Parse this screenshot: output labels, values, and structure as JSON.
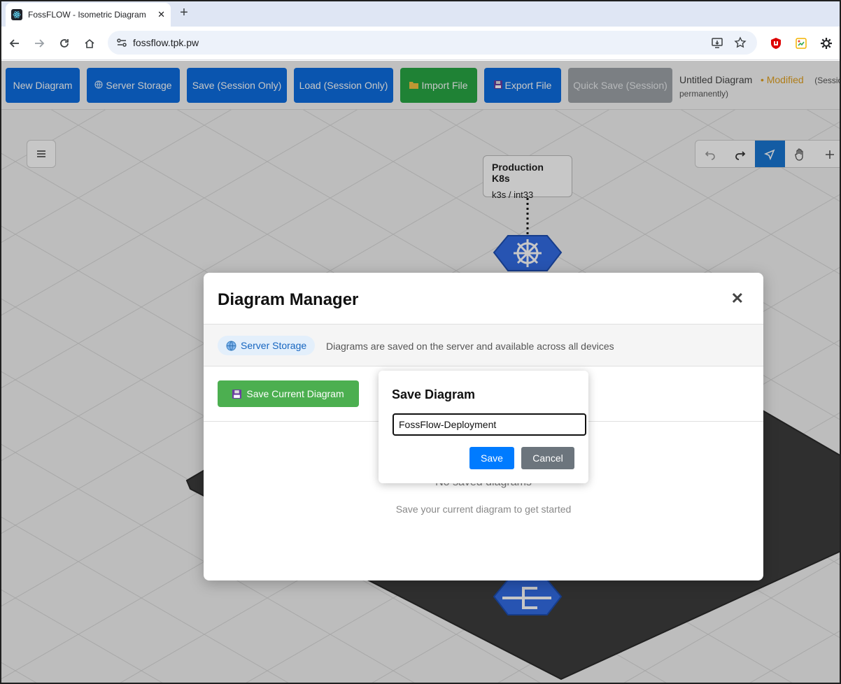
{
  "browser": {
    "tab_title": "FossFLOW - Isometric Diagram",
    "tab_close": "✕",
    "new_tab": "+",
    "url": "fossflow.tpk.pw"
  },
  "appbar": {
    "buttons": [
      {
        "label": "New Diagram",
        "icon": "",
        "color": "blue"
      },
      {
        "label": "Server Storage",
        "icon": "globe-icon",
        "color": "blue"
      },
      {
        "label": "Save (Session Only)",
        "icon": "",
        "color": "blue"
      },
      {
        "label": "Load (Session Only)",
        "icon": "",
        "color": "blue"
      },
      {
        "label": "Import File",
        "icon": "folder-icon",
        "color": "green"
      },
      {
        "label": "Export File",
        "icon": "floppy-icon",
        "color": "blue"
      },
      {
        "label": "Quick Save (Session)",
        "icon": "",
        "color": "gray"
      }
    ],
    "diagram_title": "Untitled Diagram",
    "modified": "• Modified",
    "session_note": "(Session",
    "session_note_2": "permanently)"
  },
  "canvas": {
    "node_title": "Production K8s",
    "node_subtitle": "k3s / int33"
  },
  "modal": {
    "title": "Diagram Manager",
    "close": "✕",
    "storage_label": "Server Storage",
    "storage_description": "Diagrams are saved on the server and available across all devices",
    "save_current_label": "Save Current Diagram",
    "empty_title": "No saved diagrams",
    "empty_subtitle": "Save your current diagram to get started"
  },
  "save_dialog": {
    "title": "Save Diagram",
    "input_value": "FossFlow-Deployment",
    "save_label": "Save",
    "cancel_label": "Cancel"
  },
  "colors": {
    "primary_blue": "#0d6ee0",
    "green": "#28a745",
    "modified": "#e0a020"
  }
}
